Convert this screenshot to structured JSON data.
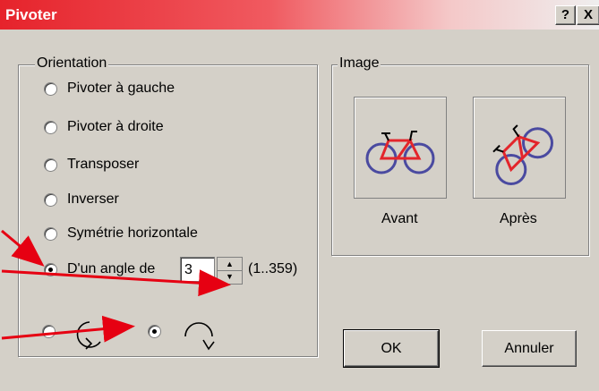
{
  "window": {
    "title": "Pivoter",
    "help_label": "?",
    "close_label": "X"
  },
  "orientation": {
    "legend": "Orientation",
    "options": [
      {
        "label": "Pivoter à gauche",
        "checked": false
      },
      {
        "label": "Pivoter à droite",
        "checked": false
      },
      {
        "label": "Transposer",
        "checked": false
      },
      {
        "label": "Inverser",
        "checked": false
      },
      {
        "label": "Symétrie horizontale",
        "checked": false
      },
      {
        "label": "D'un angle de",
        "checked": true
      }
    ],
    "angle": {
      "value": "3",
      "range": "(1..359)"
    },
    "direction": {
      "counterclockwise_checked": false,
      "clockwise_checked": true
    }
  },
  "image": {
    "legend": "Image",
    "before_label": "Avant",
    "after_label": "Après"
  },
  "buttons": {
    "ok": "OK",
    "cancel": "Annuler"
  },
  "colors": {
    "annotation_arrow": "#e60012",
    "title_gradient_start": "#e6232b"
  }
}
